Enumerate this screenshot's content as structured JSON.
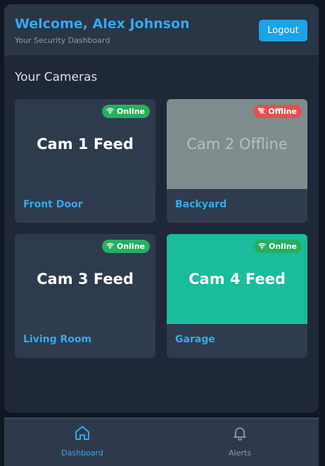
{
  "header": {
    "welcome": "Welcome, Alex Johnson",
    "subtitle": "Your Security Dashboard",
    "logout_label": "Logout"
  },
  "section_title": "Your Cameras",
  "cameras": [
    {
      "feed": "Cam 1 Feed",
      "name": "Front Door",
      "status": "Online",
      "status_icon": "wifi-icon"
    },
    {
      "feed": "Cam 2 Offline",
      "name": "Backyard",
      "status": "Offline",
      "status_icon": "wifi-off-icon"
    },
    {
      "feed": "Cam 3 Feed",
      "name": "Living Room",
      "status": "Online",
      "status_icon": "wifi-icon"
    },
    {
      "feed": "Cam 4 Feed",
      "name": "Garage",
      "status": "Online",
      "status_icon": "wifi-icon"
    }
  ],
  "nav": [
    {
      "label": "Dashboard",
      "icon": "home-icon",
      "active": true
    },
    {
      "label": "Alerts",
      "icon": "bell-icon",
      "active": false
    }
  ],
  "colors": {
    "accent": "#37a9ec",
    "online": "#27ae60",
    "offline": "#e05252",
    "feed_highlight": "#1abc9c"
  }
}
